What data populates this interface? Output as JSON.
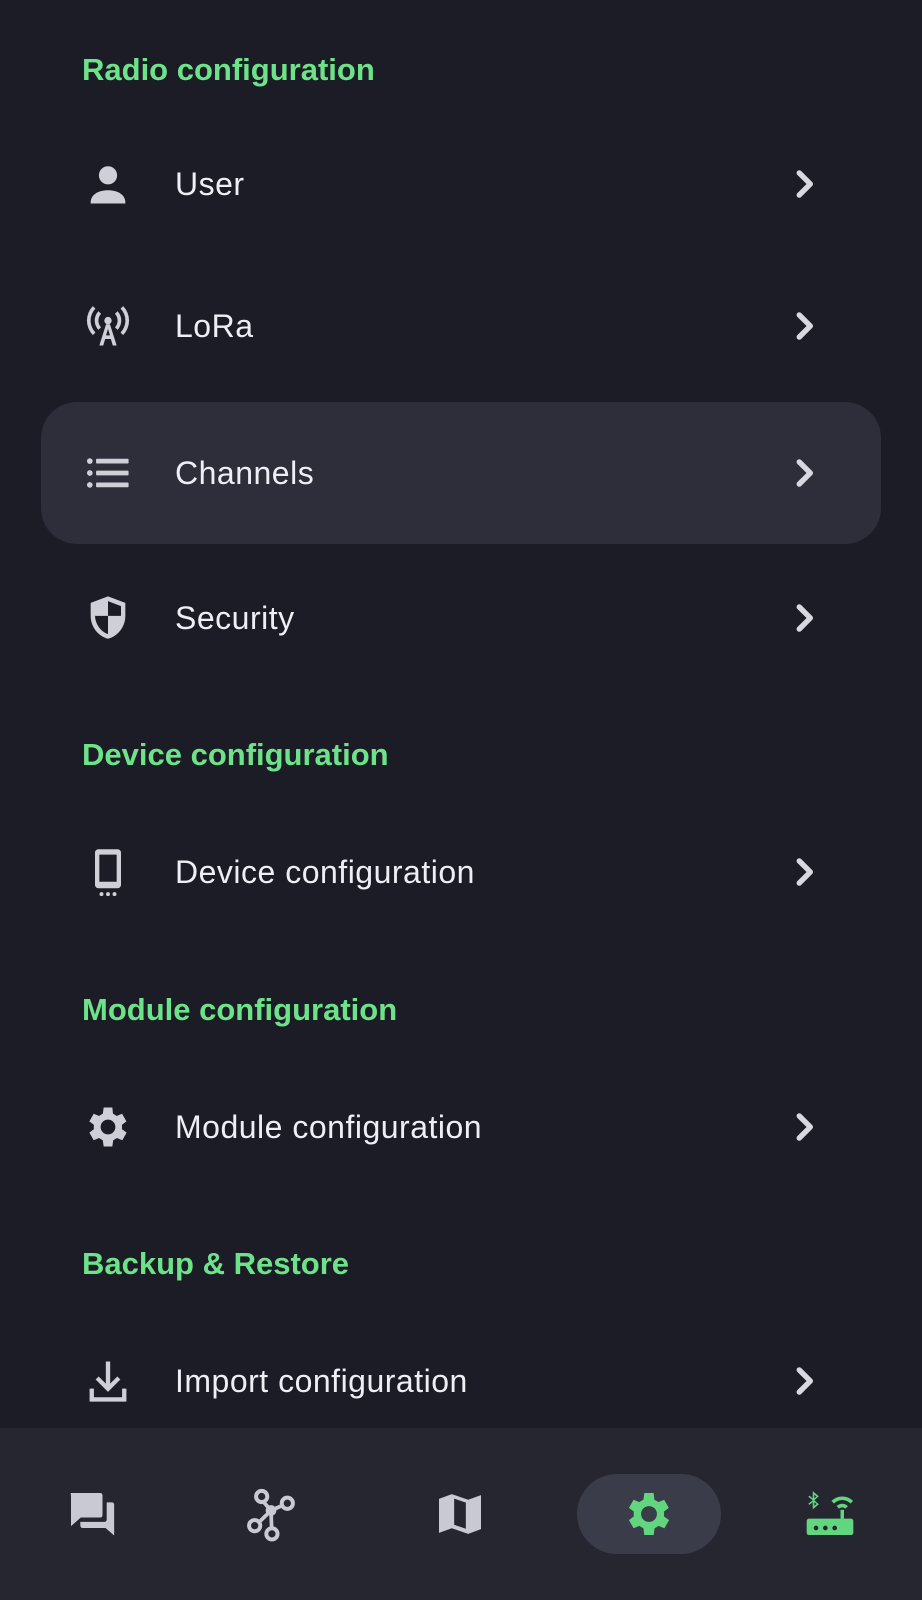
{
  "sections": {
    "radio": {
      "title": "Radio configuration"
    },
    "device": {
      "title": "Device configuration"
    },
    "module": {
      "title": "Module configuration"
    },
    "backup": {
      "title": "Backup & Restore"
    }
  },
  "items": {
    "user": {
      "label": "User",
      "icon": "person-icon"
    },
    "lora": {
      "label": "LoRa",
      "icon": "cell-tower-icon"
    },
    "channels": {
      "label": "Channels",
      "icon": "list-icon",
      "highlighted": true
    },
    "security": {
      "label": "Security",
      "icon": "shield-icon"
    },
    "device_configuration": {
      "label": "Device configuration",
      "icon": "phone-device-icon"
    },
    "module_configuration": {
      "label": "Module configuration",
      "icon": "gear-icon"
    },
    "import_configuration": {
      "label": "Import configuration",
      "icon": "download-icon"
    }
  },
  "bottom_nav": {
    "items": [
      {
        "id": "messages",
        "icon": "chat-bubbles-icon"
      },
      {
        "id": "nodes",
        "icon": "network-nodes-icon"
      },
      {
        "id": "map",
        "icon": "map-icon"
      },
      {
        "id": "settings",
        "icon": "gear-icon",
        "active": true
      },
      {
        "id": "connections",
        "icon": "bluetooth-router-icon"
      }
    ]
  },
  "colors": {
    "background": "#1c1c26",
    "accent": "#6de389",
    "highlight_row": "#2e2e3b",
    "bottom_nav": "#262631",
    "active_pill": "#3b3c4a"
  }
}
